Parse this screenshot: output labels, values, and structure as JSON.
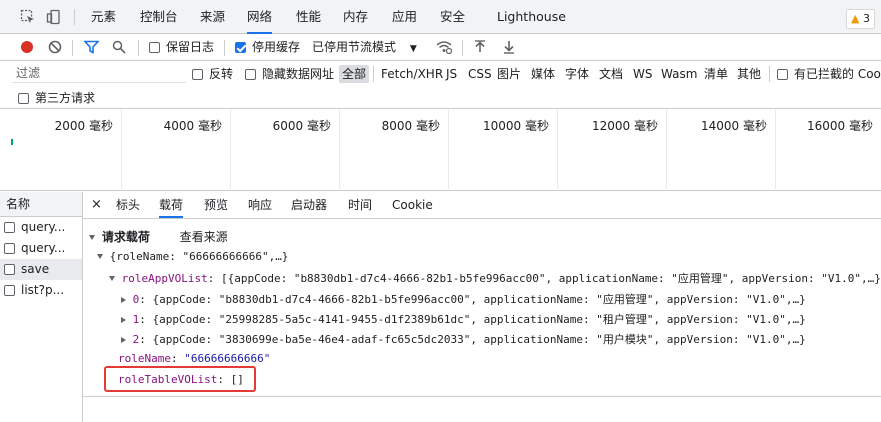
{
  "devtools": {
    "tabs": [
      "元素",
      "控制台",
      "来源",
      "网络",
      "性能",
      "内存",
      "应用",
      "安全",
      "Lighthouse"
    ],
    "active_tab": "网络",
    "issues_count": "3"
  },
  "toolbar": {
    "preserve_log": "保留日志",
    "disable_cache": "停用缓存",
    "throttling": "已停用节流模式"
  },
  "filter": {
    "placeholder": "过滤",
    "invert": "反转",
    "hide_data_urls": "隐藏数据网址",
    "types": [
      "全部",
      "Fetch/XHR",
      "JS",
      "CSS",
      "图片",
      "媒体",
      "字体",
      "文档",
      "WS",
      "Wasm",
      "清单",
      "其他"
    ],
    "blocked_cookies": "有已拦截的 Cookie",
    "third_party": "第三方请求"
  },
  "timeline": {
    "ticks": [
      "2000 毫秒",
      "4000 毫秒",
      "6000 毫秒",
      "8000 毫秒",
      "10000 毫秒",
      "12000 毫秒",
      "14000 毫秒",
      "16000 毫秒"
    ]
  },
  "requests": {
    "header": "名称",
    "items": [
      "query...",
      "query...",
      "save",
      "list?p..."
    ],
    "selected_index": 2
  },
  "details": {
    "tabs": [
      "标头",
      "载荷",
      "预览",
      "响应",
      "启动器",
      "时间",
      "Cookie"
    ],
    "active_tab": "载荷",
    "section_title": "请求载荷",
    "view_source": "查看来源",
    "payload": {
      "root": "{roleName: \"66666666666\",…}",
      "app_list_key": "roleAppVOList",
      "app_list_summary": "[{appCode: \"b8830db1-d7c4-4666-82b1-b5fe996acc00\", applicationName: \"应用管理\", appVersion: \"V1.0\",…},…]",
      "items": [
        {
          "index": "0",
          "summary": "{appCode: \"b8830db1-d7c4-4666-82b1-b5fe996acc00\", applicationName: \"应用管理\", appVersion: \"V1.0\",…}"
        },
        {
          "index": "1",
          "summary": "{appCode: \"25998285-5a5c-4141-9455-d1f2389b61dc\", applicationName: \"租户管理\", appVersion: \"V1.0\",…}"
        },
        {
          "index": "2",
          "summary": "{appCode: \"3830699e-ba5e-46e4-adaf-fc65c5dc2033\", applicationName: \"用户模块\", appVersion: \"V1.0\",…}"
        }
      ],
      "role_name_key": "roleName",
      "role_name_value": "\"66666666666\"",
      "role_table_key": "roleTableVOList",
      "role_table_value": "[]"
    }
  },
  "colors": {
    "accent": "#1a73e8",
    "record": "#d93025",
    "highlight_box": "#e53935"
  }
}
